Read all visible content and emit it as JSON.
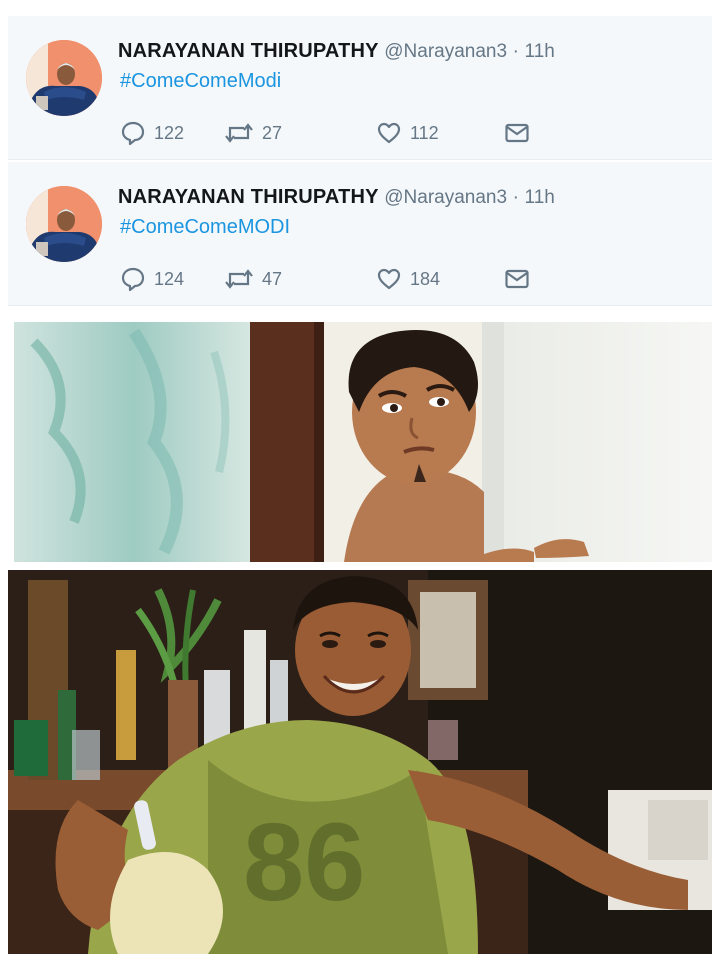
{
  "tweets": [
    {
      "name": "NARAYANAN THIRUPATHY",
      "handle": "@Narayanan3",
      "separator": "·",
      "time": "11h",
      "hashtag": "#ComeComeModi",
      "replies": "122",
      "retweets": "27",
      "likes": "112"
    },
    {
      "name": "NARAYANAN THIRUPATHY",
      "handle": "@Narayanan3",
      "separator": "·",
      "time": "11h",
      "hashtag": "#ComeComeMODI",
      "replies": "124",
      "retweets": "47",
      "likes": "184"
    }
  ],
  "icons": {
    "reply": "reply-icon",
    "retweet": "retweet-icon",
    "like": "heart-icon",
    "message": "envelope-icon"
  },
  "colors": {
    "link": "#1b95e0",
    "muted": "#657786",
    "tweet_bg": "#f5f8fa",
    "avatar_bg": "#f08f6c"
  }
}
